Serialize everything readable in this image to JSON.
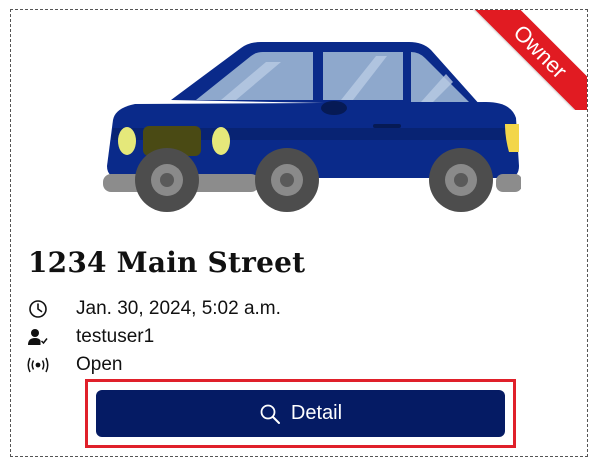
{
  "listing": {
    "badge": "Owner",
    "title": "1234 Main Street",
    "meta": {
      "date": "Jan. 30, 2024, 5:02 a.m.",
      "user": "testuser1",
      "status": "Open"
    },
    "detail_button_label": "Detail"
  },
  "colors": {
    "accent_red": "#e11b22",
    "button_bg": "#051b64",
    "car_body": "#0a2a8a"
  },
  "icons": {
    "clock": "clock-icon",
    "user": "user-check-icon",
    "status": "broadcast-icon",
    "search": "search-icon"
  }
}
